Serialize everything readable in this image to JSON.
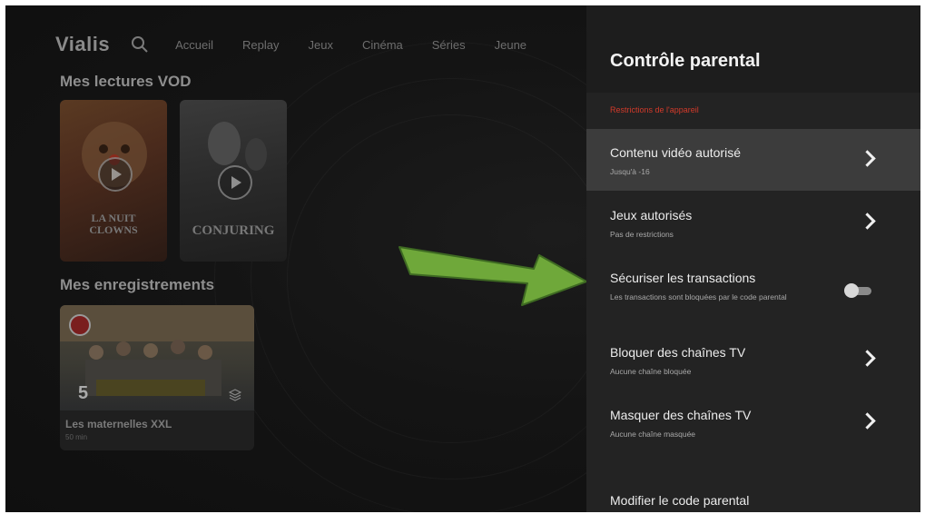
{
  "app": {
    "logo": "Vialis"
  },
  "nav": {
    "items": [
      "Accueil",
      "Replay",
      "Jeux",
      "Cinéma",
      "Séries",
      "Jeune"
    ]
  },
  "home": {
    "vod_title": "Mes lectures VOD",
    "vod_posters": [
      {
        "title": "LA NUIT\nCLOWNS"
      },
      {
        "title": "CONJURING"
      }
    ],
    "recordings_title": "Mes enregistrements",
    "recording": {
      "title": "Les maternelles XXL",
      "duration": "50 min",
      "channel_number": "5"
    }
  },
  "panel": {
    "title": "Contrôle parental",
    "section_label": "Restrictions de l'appareil",
    "rows": [
      {
        "label": "Contenu vidéo autorisé",
        "sub": "Jusqu'à -16"
      },
      {
        "label": "Jeux autorisés",
        "sub": "Pas de restrictions"
      },
      {
        "label": "Sécuriser les transactions",
        "sub": "Les transactions sont bloquées par le code parental",
        "toggle_on": false
      },
      {
        "label": "Bloquer des chaînes TV",
        "sub": "Aucune chaîne bloquée"
      },
      {
        "label": "Masquer des chaînes TV",
        "sub": "Aucune chaîne masquée"
      }
    ],
    "bottom_label": "Modifier le code parental"
  },
  "colors": {
    "accent_red": "#d23a2a",
    "arrow_green": "#6fa83a",
    "panel_bg": "#232323",
    "selected_row_bg": "#3c3c3c"
  }
}
